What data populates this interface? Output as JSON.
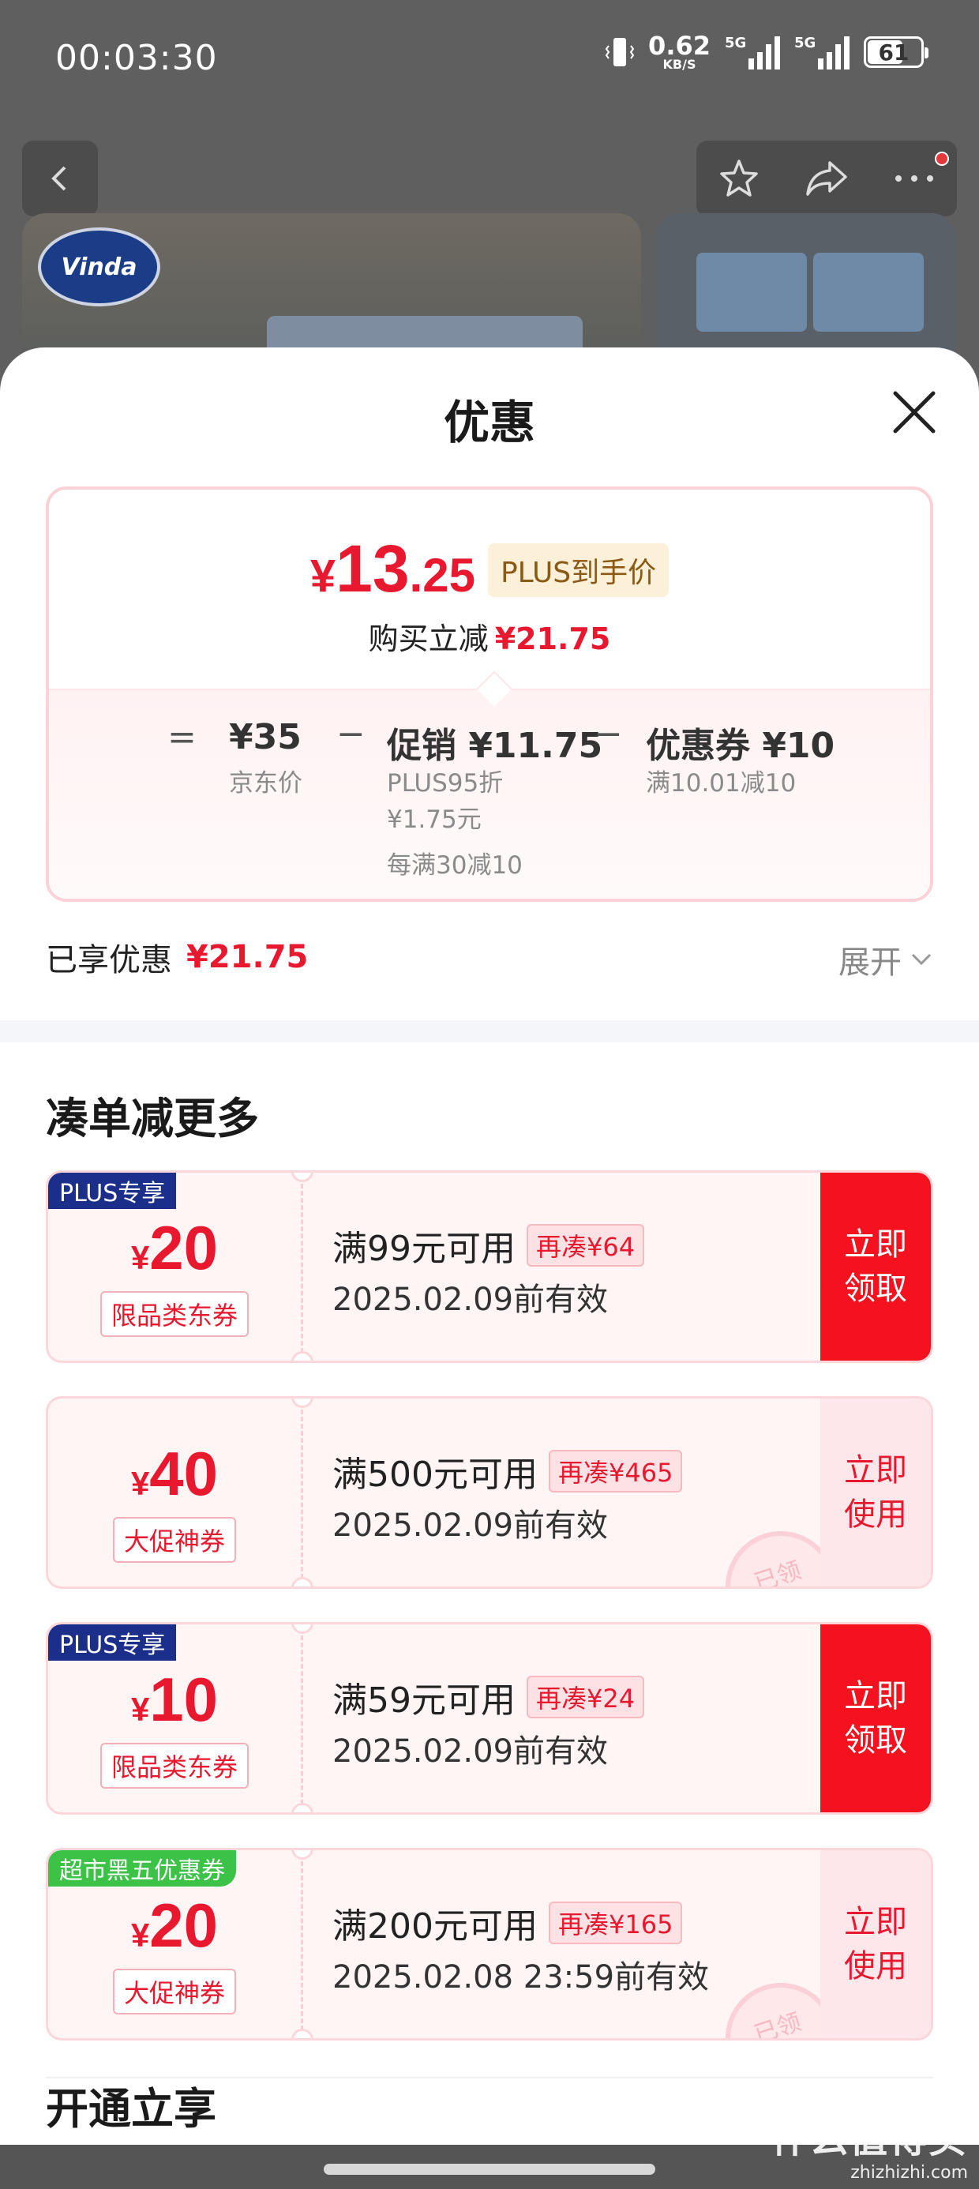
{
  "status_bar": {
    "time": "00:03:30",
    "net_speed": "0.62",
    "net_unit": "KB/S",
    "sim1_type": "5G",
    "sim2_type": "5G",
    "battery": "61"
  },
  "background": {
    "brand_logo_text": "Vinda"
  },
  "sheet": {
    "title": "优惠",
    "price_card": {
      "final_currency": "¥",
      "final_int": "13",
      "final_dec": ".25",
      "plus_tag": "PLUS到手价",
      "save_label": "购买立减",
      "save_amount": "¥21.75",
      "formula": {
        "eq": "=",
        "minus": "−",
        "base_value": "¥35",
        "base_label": "京东价",
        "promo_value": "促销 ¥11.75",
        "promo_line1": "PLUS95折",
        "promo_line2": "¥1.75元",
        "promo_line3": "每满30减10",
        "coupon_value": "优惠券 ¥10",
        "coupon_label": "满10.01减10"
      }
    },
    "enjoyed": {
      "label": "已享优惠",
      "amount": "¥21.75",
      "expand_label": "展开"
    },
    "section_title": "凑单减更多",
    "coupons": [
      {
        "badge": "PLUS专享",
        "currency": "¥",
        "amount": "20",
        "type": "限品类东券",
        "condition": "满99元可用",
        "gap": "再凑¥64",
        "valid": "2025.02.09前有效",
        "btn_line1": "立即",
        "btn_line2": "领取",
        "claimed": ""
      },
      {
        "badge": "",
        "currency": "¥",
        "amount": "40",
        "type": "大促神券",
        "condition": "满500元可用",
        "gap": "再凑¥465",
        "valid": "2025.02.09前有效",
        "btn_line1": "立即",
        "btn_line2": "使用",
        "claimed": "已领"
      },
      {
        "badge": "PLUS专享",
        "currency": "¥",
        "amount": "10",
        "type": "限品类东券",
        "condition": "满59元可用",
        "gap": "再凑¥24",
        "valid": "2025.02.09前有效",
        "btn_line1": "立即",
        "btn_line2": "领取",
        "claimed": ""
      },
      {
        "badge": "超市黑五优惠券",
        "currency": "¥",
        "amount": "20",
        "type": "大促神券",
        "condition": "满200元可用",
        "gap": "再凑¥165",
        "valid": "2025.02.08 23:59前有效",
        "btn_line1": "立即",
        "btn_line2": "使用",
        "claimed": "已领"
      }
    ],
    "next_section_title": "开通立享"
  },
  "watermark": {
    "line1": "什么值得买",
    "line2": "zhizhizhi.com"
  },
  "colors": {
    "accent_red": "#e8182f",
    "button_red": "#f4121f",
    "plus_navy": "#1b2f8a",
    "market_green": "#3cc247"
  }
}
